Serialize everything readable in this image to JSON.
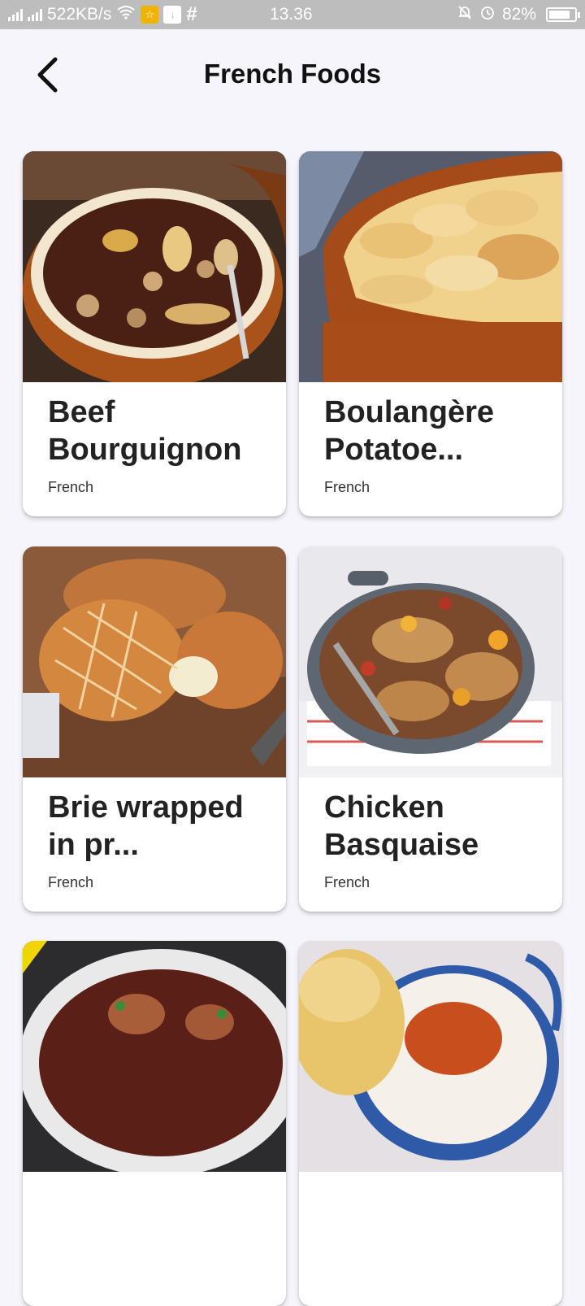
{
  "status_bar": {
    "network_speed": "522KB/s",
    "time": "13.36",
    "battery_percent": "82%",
    "battery_level": 0.82
  },
  "header": {
    "title": "French Foods"
  },
  "recipes": [
    {
      "name": "Beef Bourguignon",
      "category": "French"
    },
    {
      "name": "Boulangère Potatoe...",
      "category": "French"
    },
    {
      "name": "Brie wrapped in pr...",
      "category": "French"
    },
    {
      "name": "Chicken Basquaise",
      "category": "French"
    },
    {
      "name": "",
      "category": ""
    },
    {
      "name": "",
      "category": ""
    }
  ]
}
